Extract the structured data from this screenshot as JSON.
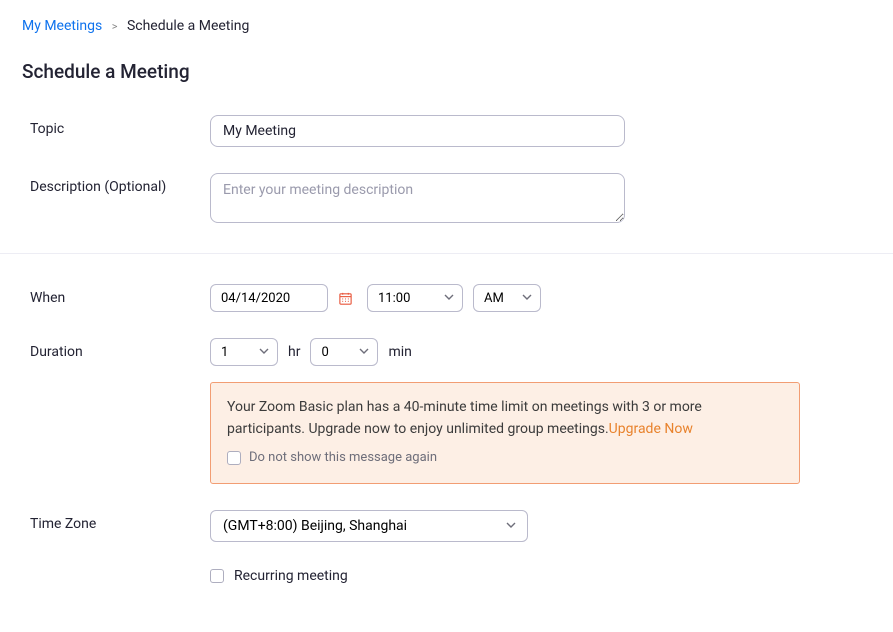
{
  "breadcrumb": {
    "parent": "My Meetings",
    "current": "Schedule a Meeting"
  },
  "page_title": "Schedule a Meeting",
  "labels": {
    "topic": "Topic",
    "description": "Description (Optional)",
    "when": "When",
    "duration": "Duration",
    "time_zone": "Time Zone"
  },
  "fields": {
    "topic_value": "My Meeting",
    "description_placeholder": "Enter your meeting description",
    "date_value": "04/14/2020",
    "time_value": "11:00",
    "ampm_value": "AM",
    "duration_hr": "1",
    "duration_min": "0",
    "timezone_value": "(GMT+8:00) Beijing, Shanghai"
  },
  "units": {
    "hr": "hr",
    "min": "min"
  },
  "warning": {
    "text1": "Your Zoom Basic plan has a 40-minute time limit on meetings with 3 or more participants. Upgrade now to enjoy unlimited group meetings.",
    "upgrade_link": "Upgrade Now",
    "dismiss_label": "Do not show this message again"
  },
  "recurring": {
    "label": "Recurring meeting"
  }
}
